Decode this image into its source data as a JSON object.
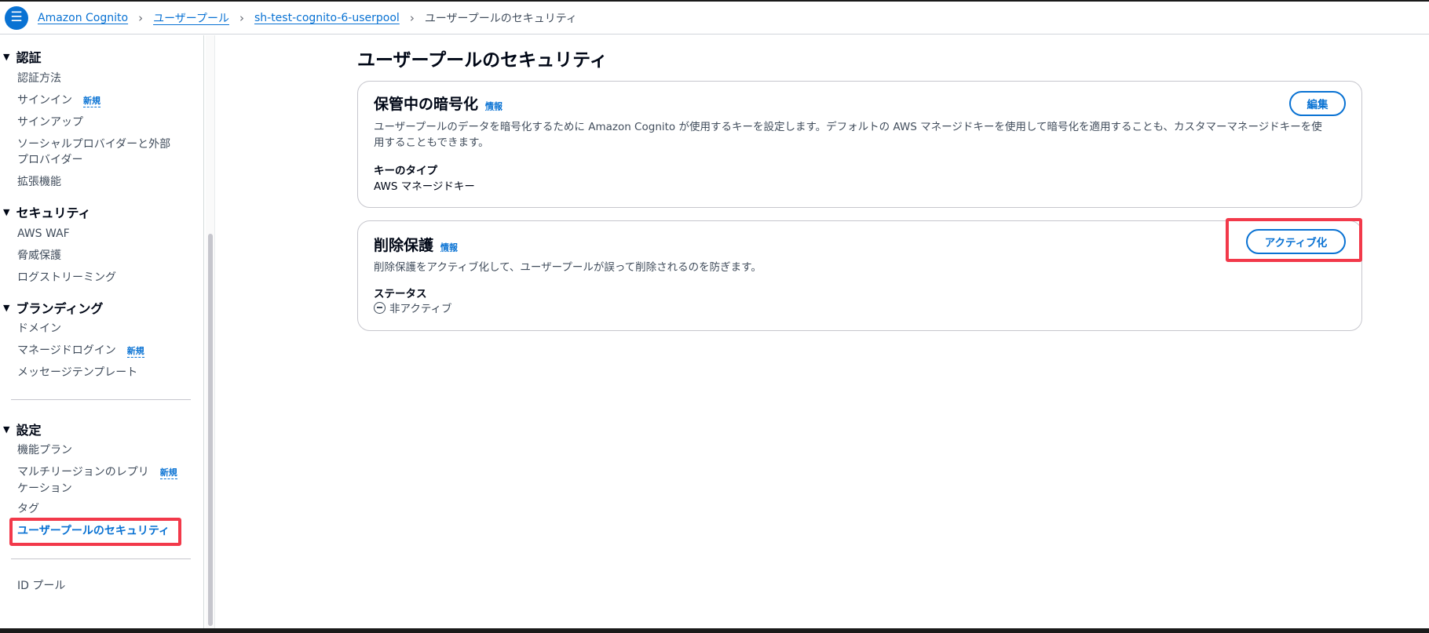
{
  "breadcrumb": {
    "items": [
      "Amazon Cognito",
      "ユーザープール",
      "sh-test-cognito-6-userpool"
    ],
    "current": "ユーザープールのセキュリティ"
  },
  "sidebar": {
    "sections": {
      "auth": {
        "title": "認証",
        "items": [
          "認証方法",
          "サインイン",
          "サインアップ",
          "ソーシャルプロバイダーと外部",
          "プロバイダー",
          "拡張機能"
        ]
      },
      "security": {
        "title": "セキュリティ",
        "items": [
          "AWS WAF",
          "脅威保護",
          "ログストリーミング"
        ]
      },
      "branding": {
        "title": "ブランディング",
        "items": [
          "ドメイン",
          "マネージドログイン",
          "メッセージテンプレート"
        ]
      },
      "settings": {
        "title": "設定",
        "items": [
          "機能プラン",
          "マルチリージョンのレプリ",
          "ケーション",
          "タグ",
          "ユーザープールのセキュリティ"
        ]
      }
    },
    "new_badge": "新規",
    "id_pool": "ID プール"
  },
  "main": {
    "title": "ユーザープールのセキュリティ",
    "encryption": {
      "title": "保管中の暗号化",
      "info": "情報",
      "edit_button": "編集",
      "description_line1": "ユーザープールのデータを暗号化するために Amazon Cognito が使用するキーを設定します。デフォルトの AWS マネージドキーを使用して暗号化を適用することも、カスタマーマネージドキーを使",
      "description_line2": "用することもできます。",
      "key_type_label": "キーのタイプ",
      "key_type_value": "AWS マネージドキー"
    },
    "deletion": {
      "title": "削除保護",
      "info": "情報",
      "activate_button": "アクティブ化",
      "description": "削除保護をアクティブ化して、ユーザープールが誤って削除されるのを防ぎます。",
      "status_label": "ステータス",
      "status_value": "非アクティブ"
    }
  },
  "colors": {
    "link": "#0972d3",
    "highlight": "#f2394a",
    "text": "#000716",
    "secondary_text": "#414d5c"
  }
}
